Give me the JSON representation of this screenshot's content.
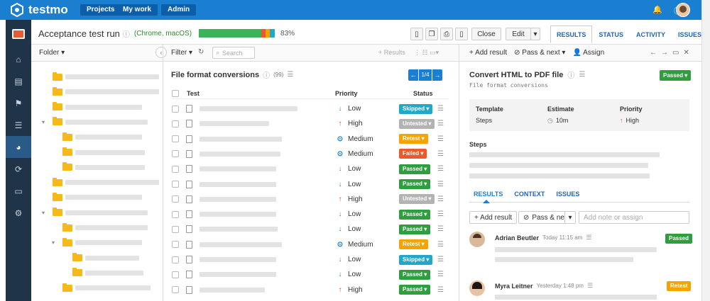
{
  "app": {
    "name": "testmo"
  },
  "topnav": {
    "projects": "Projects",
    "my_work": "My work",
    "admin": "Admin"
  },
  "run": {
    "title": "Acceptance test run",
    "config": "(Chrome, macOS)",
    "progress_pct": "83%",
    "progress_fraction": 0.83,
    "close_label": "Close",
    "edit_label": "Edit"
  },
  "right_tabs": [
    "RESULTS",
    "STATUS",
    "ACTIVITY",
    "ISSUES"
  ],
  "folder_panel": {
    "label": "Folder"
  },
  "list_toolbar": {
    "filter": "Filter",
    "search_placeholder": "Search",
    "results": "Results"
  },
  "list": {
    "title": "File format conversions",
    "count": "(99)",
    "page": "1/4",
    "col_test": "Test",
    "col_priority": "Priority",
    "col_status": "Status",
    "rows": [
      {
        "priority": "Low",
        "status": "Skipped"
      },
      {
        "priority": "High",
        "status": "Untested"
      },
      {
        "priority": "Medium",
        "status": "Retest"
      },
      {
        "priority": "Medium",
        "status": "Failed"
      },
      {
        "priority": "Low",
        "status": "Passed"
      },
      {
        "priority": "Low",
        "status": "Passed"
      },
      {
        "priority": "High",
        "status": "Untested"
      },
      {
        "priority": "Low",
        "status": "Passed"
      },
      {
        "priority": "Low",
        "status": "Passed"
      },
      {
        "priority": "Medium",
        "status": "Retest"
      },
      {
        "priority": "Low",
        "status": "Skipped"
      },
      {
        "priority": "Low",
        "status": "Passed"
      },
      {
        "priority": "High",
        "status": "Passed"
      }
    ]
  },
  "detail_toolbar": {
    "add_result": "Add result",
    "pass_next": "Pass & next",
    "assign": "Assign"
  },
  "detail": {
    "title": "Convert HTML to PDF file",
    "folder": "File format conversions",
    "status": "Passed",
    "template_label": "Template",
    "template_value": "Steps",
    "estimate_label": "Estimate",
    "estimate_value": "10m",
    "priority_label": "Priority",
    "priority_value": "High",
    "steps_label": "Steps"
  },
  "sub_tabs": [
    "RESULTS",
    "CONTEXT",
    "ISSUES"
  ],
  "result_actions": {
    "add_result": "+ Add result",
    "pass_next": "Pass & next",
    "note_placeholder": "Add note or assign"
  },
  "results": [
    {
      "user": "Adrian Beutler",
      "time": "Today 11:15 am",
      "status": "Passed"
    },
    {
      "user": "Myra Leitner",
      "time": "Yesterday 1:48 pm",
      "status": "Retest"
    }
  ],
  "colors": {
    "topbar": "#1b7fd1",
    "sidebar": "#1f3448",
    "passed": "#2e9e3f",
    "failed": "#ea5a2e",
    "retest": "#f5a300",
    "skipped": "#20a7c9",
    "untested": "#b3b3b3",
    "link": "#2264b0"
  }
}
